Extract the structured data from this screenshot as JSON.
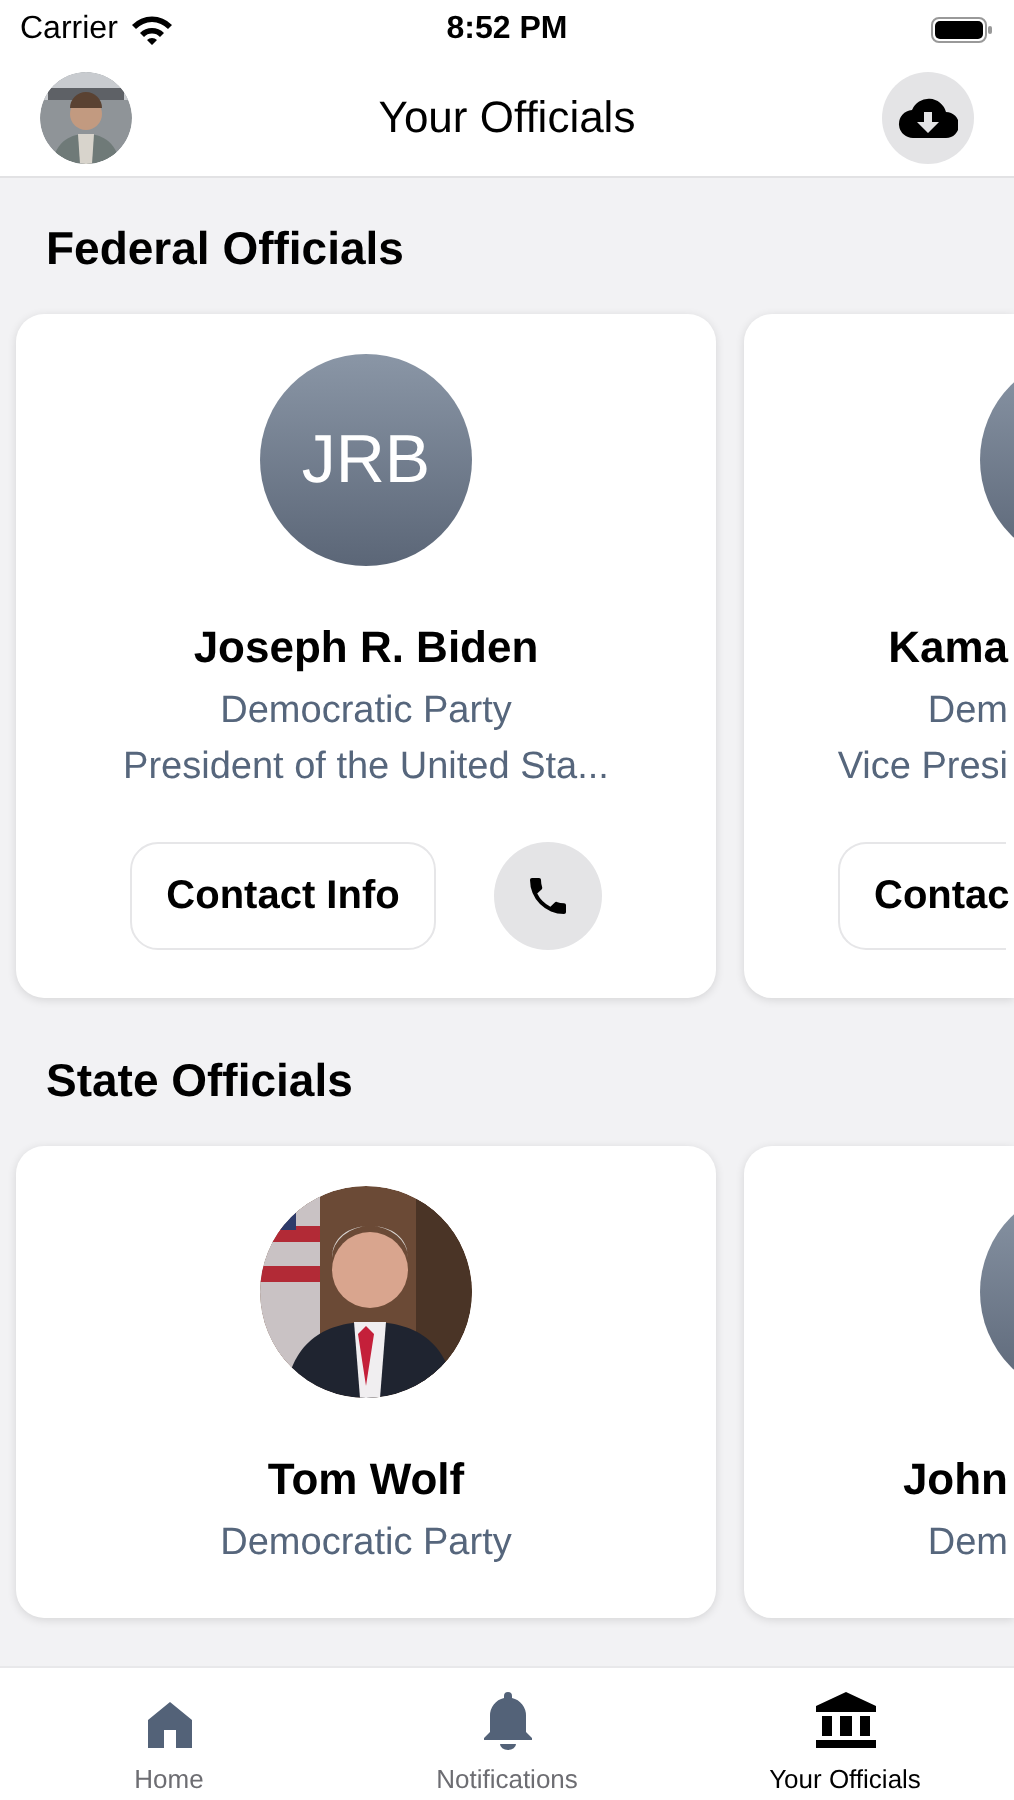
{
  "status_bar": {
    "carrier": "Carrier",
    "time": "8:52 PM"
  },
  "header": {
    "title": "Your Officials"
  },
  "sections": [
    {
      "title": "Federal Officials",
      "cards": [
        {
          "kind": "initials",
          "initials": "JRB",
          "name": "Joseph R. Biden",
          "party": "Democratic Party",
          "role": "President of the United Sta...",
          "contact": "Contact Info",
          "phone": true
        },
        {
          "kind": "blank",
          "name": "Kama",
          "party": "Dem",
          "role": "Vice Presi",
          "contact": "Contac",
          "phone": false
        }
      ]
    },
    {
      "title": "State Officials",
      "cards": [
        {
          "name": "Tom Wolf",
          "party": "Democratic Party"
        },
        {
          "kind": "blank",
          "name": "John",
          "party": "Dem"
        }
      ]
    }
  ],
  "tabs": [
    {
      "label": "Home",
      "kind": "home",
      "selected": false
    },
    {
      "label": "Notifications",
      "kind": "bell",
      "selected": false
    },
    {
      "label": "Your Officials",
      "kind": "building",
      "selected": true
    }
  ]
}
